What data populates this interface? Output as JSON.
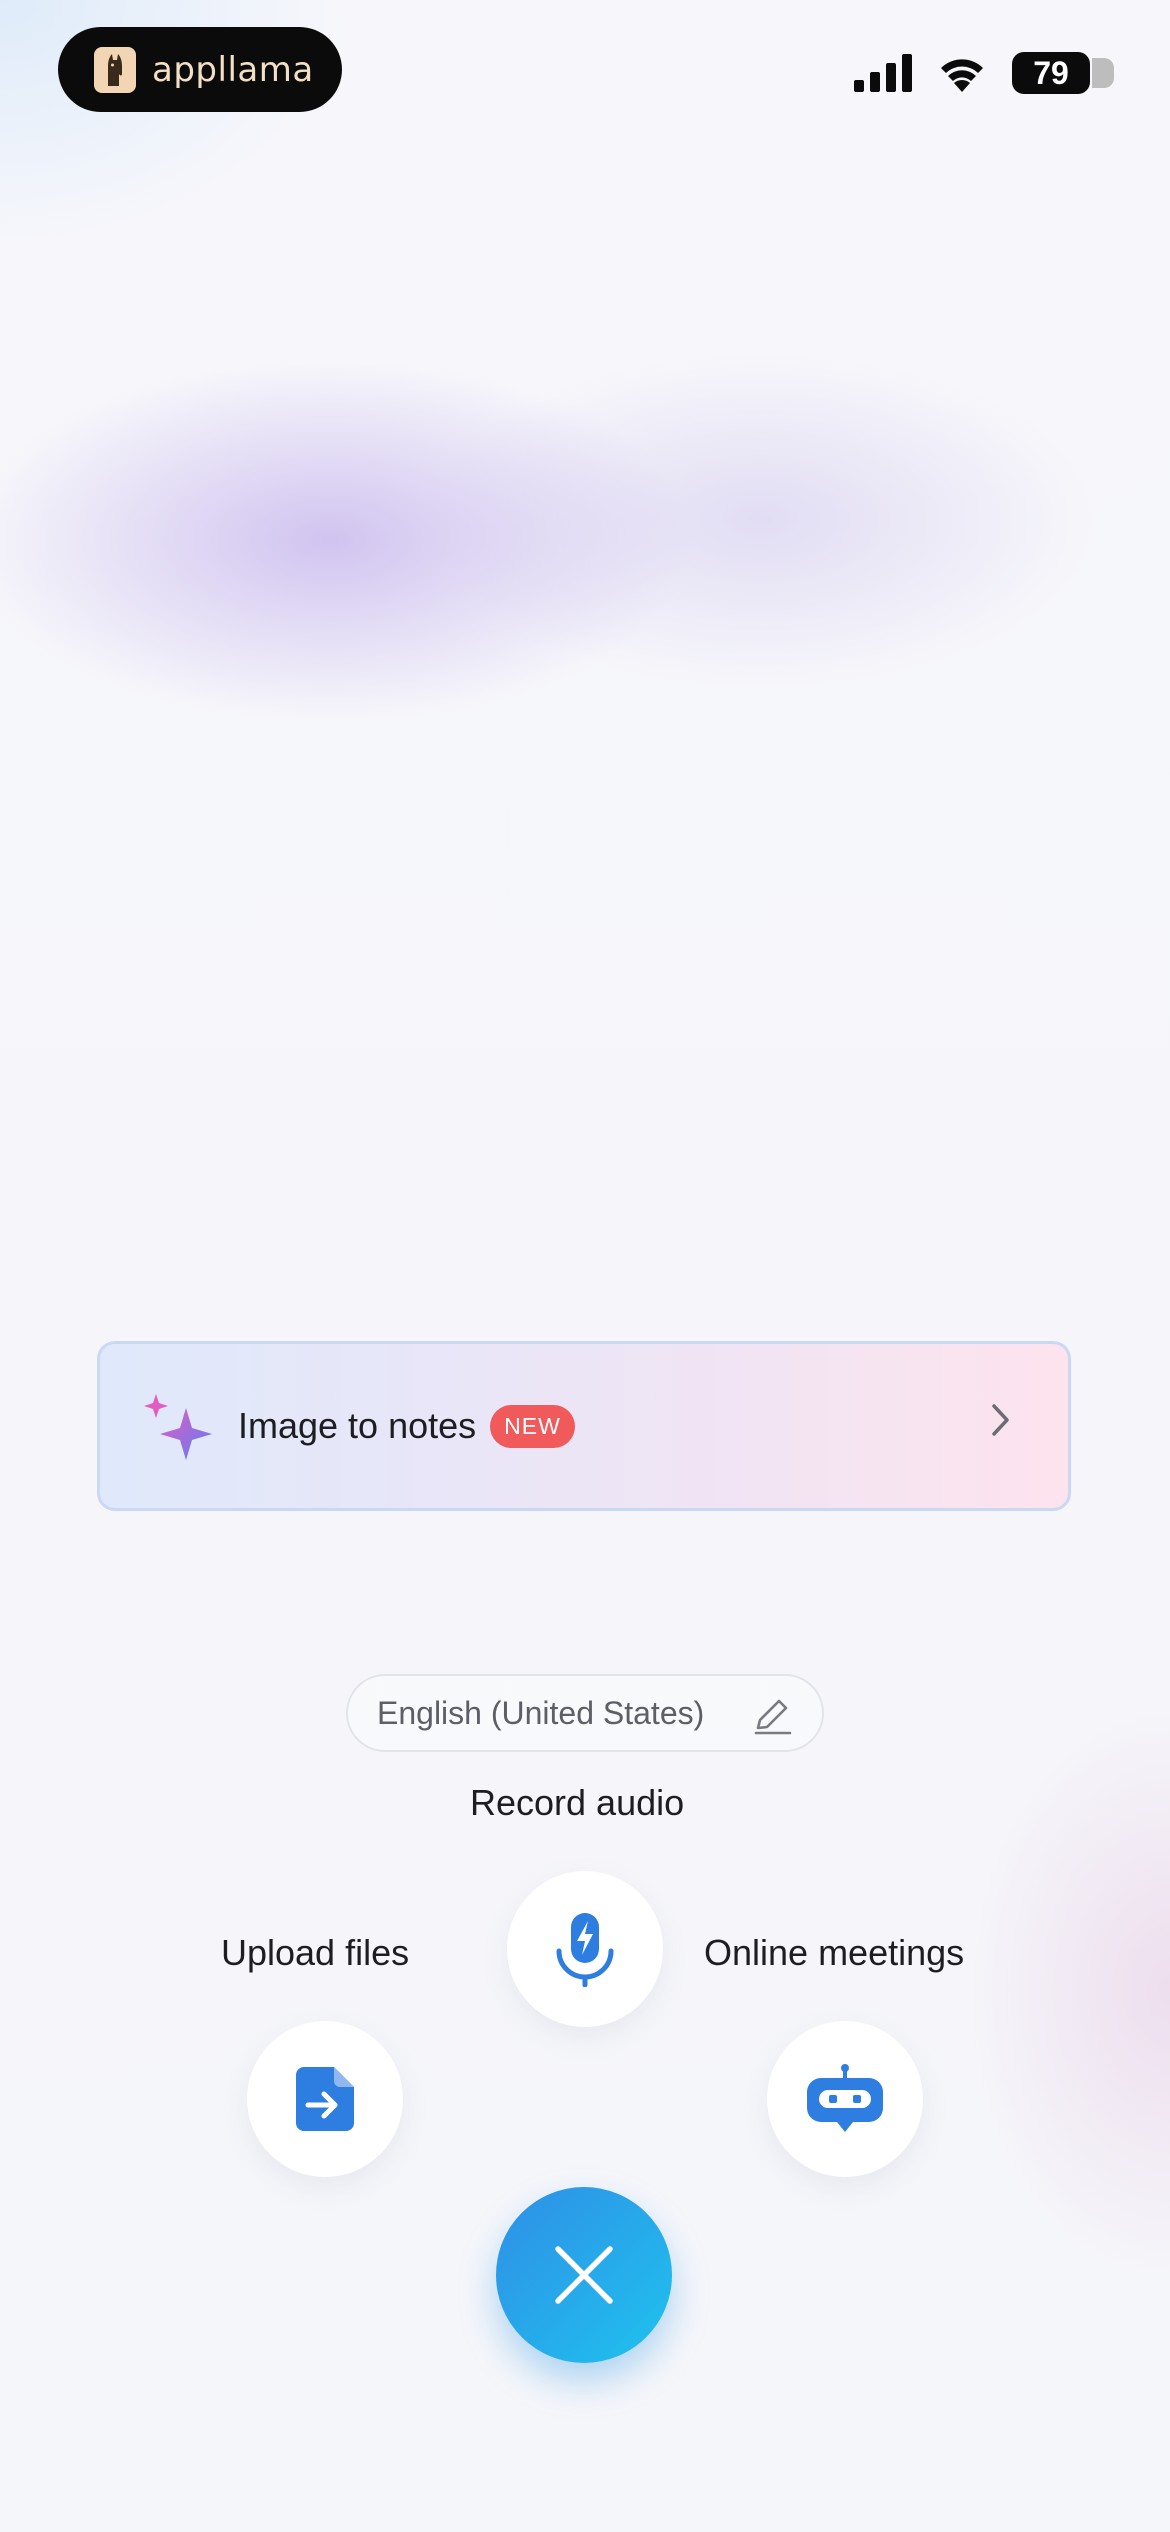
{
  "status_bar": {
    "app_badge_text": "appllama",
    "battery_level": "79",
    "signal_icon": "cellular-signal-icon",
    "wifi_icon": "wifi-icon"
  },
  "banner": {
    "title": "Image to notes",
    "badge": "NEW",
    "icon": "sparkle-icon",
    "chevron": "chevron-right-icon"
  },
  "language": {
    "label": "English (United States)",
    "icon": "pencil-icon"
  },
  "actions": {
    "record": {
      "label": "Record audio",
      "icon": "microphone-bolt-icon"
    },
    "upload": {
      "label": "Upload files",
      "icon": "file-import-icon"
    },
    "meetings": {
      "label": "Online meetings",
      "icon": "robot-icon"
    },
    "close": {
      "icon": "close-icon"
    }
  },
  "colors": {
    "accent": "#2f8fe6",
    "accent_end": "#1fc2ee",
    "badge_red": "#f05a5a"
  }
}
